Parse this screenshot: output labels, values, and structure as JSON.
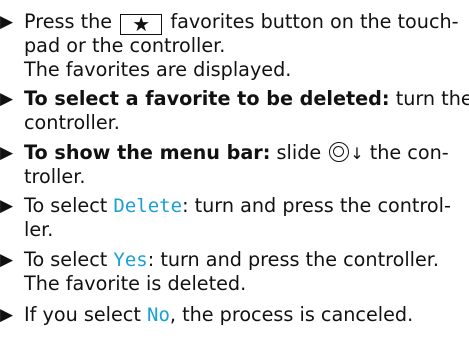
{
  "steps": [
    {
      "bullet": "▶",
      "l1a": "Press the",
      "l1b": "favorites button on the touch-",
      "l2": "pad or the controller.",
      "result": "The favorites are displayed."
    },
    {
      "bullet": "▶",
      "bold": "To select a favorite to be deleted:",
      "l1": "turn the",
      "l2": "controller."
    },
    {
      "bullet": "▶",
      "bold": "To show the menu bar:",
      "l1a": "slide",
      "l1b": "the con-",
      "l2": "troller."
    },
    {
      "bullet": "▶",
      "pre": "To select",
      "ui": "Delete",
      "l1": ": turn and press the control-",
      "l2": "ler."
    },
    {
      "bullet": "▶",
      "pre": "To select",
      "ui": "Yes",
      "l1": ": turn and press the controller.",
      "result": "The favorite is deleted."
    },
    {
      "bullet": "▶",
      "pre": "If you select",
      "ui": "No",
      "l1": ", the process is canceled."
    }
  ],
  "icons": {
    "favorites_button": "star-icon",
    "slide_down": "controller-slide-down-icon",
    "arrow": "↓"
  }
}
